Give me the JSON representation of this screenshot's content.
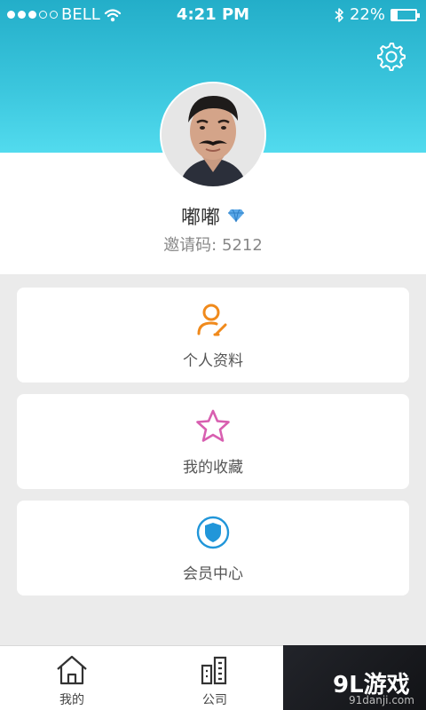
{
  "status_bar": {
    "carrier": "BELL",
    "time": "4:21 PM",
    "battery_text": "22%",
    "battery_level": 0.22,
    "signal_dots": [
      true,
      true,
      true,
      false,
      false
    ]
  },
  "header": {
    "settings_icon": "gear-icon",
    "accent_color": "#2fbcd6"
  },
  "profile": {
    "username": "嘟嘟",
    "badge_icon": "diamond-icon",
    "invite_label": "邀请码:",
    "invite_code": "5212"
  },
  "menu": [
    {
      "label": "个人资料",
      "icon": "user-edit-icon",
      "color": "#f08a1c"
    },
    {
      "label": "我的收藏",
      "icon": "star-icon",
      "color": "#d85fb0"
    },
    {
      "label": "会员中心",
      "icon": "shield-icon",
      "color": "#2196d9"
    }
  ],
  "tabbar": {
    "tabs": [
      {
        "label": "我的",
        "icon": "home-icon"
      },
      {
        "label": "公司",
        "icon": "building-icon"
      }
    ]
  },
  "watermark": {
    "brand": "9L游戏",
    "url": "91danji.com"
  }
}
